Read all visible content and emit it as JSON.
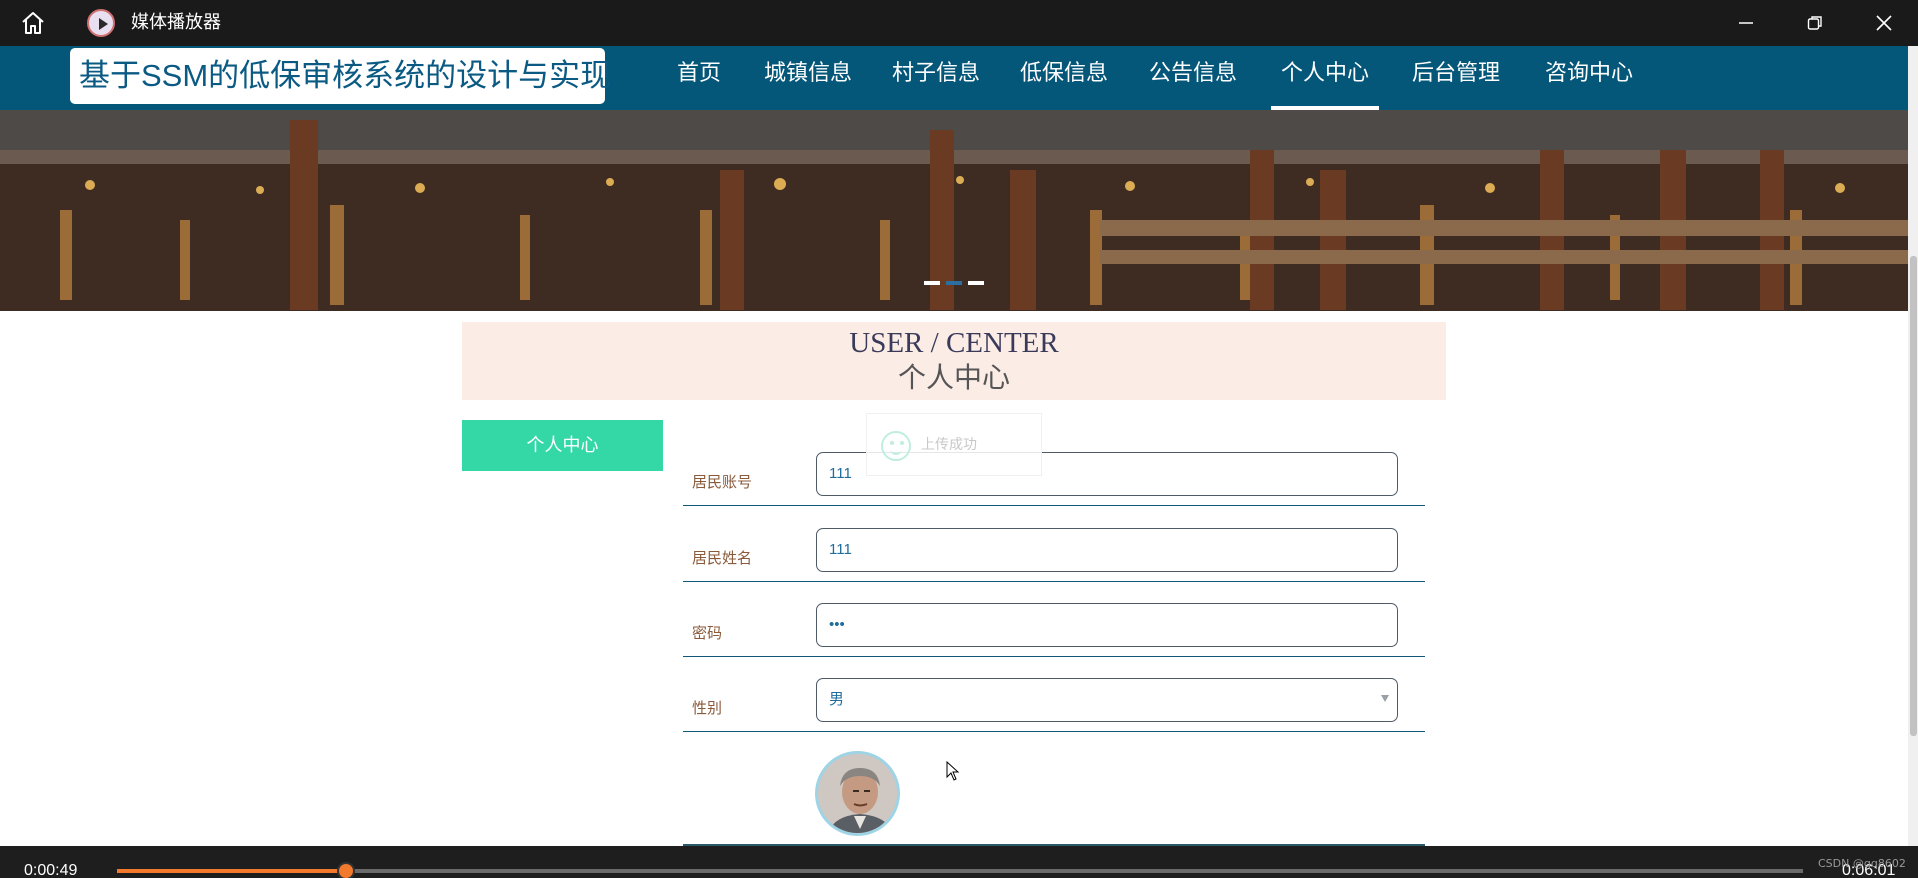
{
  "window": {
    "title": "媒体播放器",
    "icons": {
      "home": "home-icon",
      "app": "play-circle-icon",
      "minimize": "minimize-icon",
      "maximize": "restore-icon",
      "close": "close-icon"
    }
  },
  "site": {
    "title": "基于SSM的低保审核系统的设计与实现"
  },
  "nav": {
    "items": [
      {
        "label": "首页"
      },
      {
        "label": "城镇信息"
      },
      {
        "label": "村子信息"
      },
      {
        "label": "低保信息"
      },
      {
        "label": "公告信息"
      },
      {
        "label": "个人中心",
        "active": true
      },
      {
        "label": "后台管理"
      },
      {
        "label": "咨询中心"
      }
    ]
  },
  "banner": {
    "slides": 3,
    "active_slide": 2
  },
  "section": {
    "title_en": "USER / CENTER",
    "title_cn": "个人中心"
  },
  "sidebar": {
    "items": [
      {
        "label": "个人中心",
        "active": true
      }
    ]
  },
  "toast": {
    "message": "上传成功",
    "icon": "smile-icon"
  },
  "form": {
    "fields": [
      {
        "label": "居民账号",
        "value": "111"
      },
      {
        "label": "居民姓名",
        "value": "111"
      },
      {
        "label": "密码",
        "value": "•••"
      },
      {
        "label": "性别",
        "value": "男"
      }
    ]
  },
  "player": {
    "current_time": "0:00:49",
    "total_time": "0:06:01",
    "progress": 0.136
  },
  "watermark": "CSDN @qq8602",
  "colors": {
    "nav_bg": "#05577a",
    "accent_green": "#33d8a6",
    "section_bg": "#fcece6",
    "progress": "#f37a2d"
  }
}
